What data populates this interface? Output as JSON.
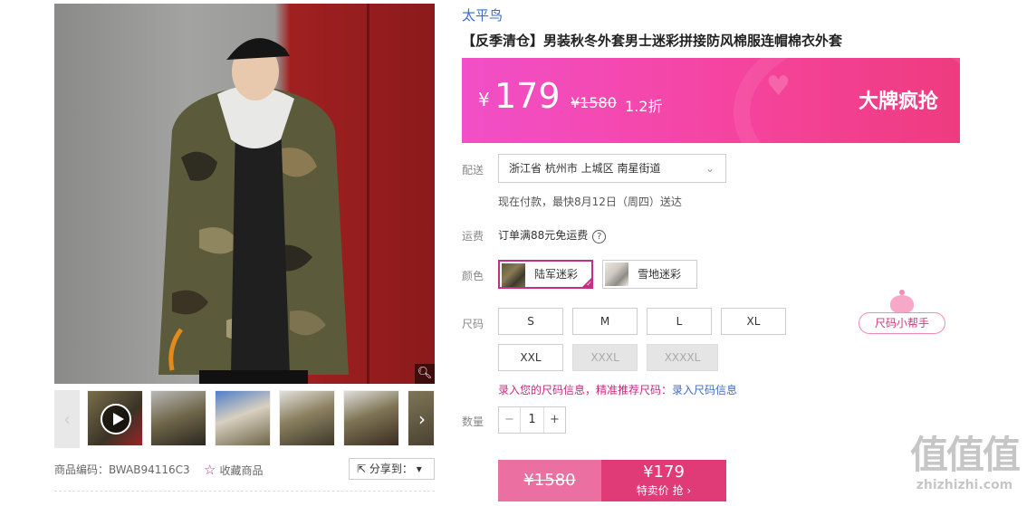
{
  "gallery": {
    "zoom_icon": "magnifier-icon",
    "prev_icon": "chevron-left-icon",
    "next_icon": "chevron-right-icon",
    "play_icon": "play-icon",
    "thumbnail_count": 7
  },
  "meta": {
    "sku": "商品编码：BWAB94116C3",
    "favorite_label": "收藏商品",
    "share_label": "分享到："
  },
  "product": {
    "brand": "太平鸟",
    "title": "【反季清仓】男装秋冬外套男士迷彩拼接防风棉服连帽棉衣外套"
  },
  "price_banner": {
    "currency": "¥",
    "price": "179",
    "original": "¥1580",
    "discount": "1.2折",
    "promo": "大牌疯抢",
    "bg_colors": [
      "#f24fc8",
      "#ee3b7f"
    ]
  },
  "shipping": {
    "label": "配送",
    "address": "浙江省 杭州市 上城区 南星街道",
    "eta": "现在付款，最快8月12日（周四）送达",
    "fee_label": "运费",
    "fee_text": "订单满88元免运费",
    "help_icon": "?"
  },
  "color": {
    "label": "颜色",
    "options": [
      {
        "name": "陆军迷彩",
        "selected": true
      },
      {
        "name": "雪地迷彩",
        "selected": false
      }
    ]
  },
  "size": {
    "label": "尺码",
    "options": [
      {
        "name": "S",
        "available": true
      },
      {
        "name": "M",
        "available": true
      },
      {
        "name": "L",
        "available": true
      },
      {
        "name": "XL",
        "available": true
      },
      {
        "name": "XXL",
        "available": true
      },
      {
        "name": "XXXL",
        "available": false
      },
      {
        "name": "XXXXL",
        "available": false
      }
    ],
    "helper": "尺码小帮手",
    "hint": "录入您的尺码信息，精准推荐尺码：",
    "hint_link": "录入尺码信息"
  },
  "quantity": {
    "label": "数量",
    "value": "1",
    "minus": "−",
    "plus": "+"
  },
  "buy": {
    "original": "¥1580",
    "special_price": "¥179",
    "action": "特卖价 抢 ›"
  },
  "watermark": {
    "big": "值值值",
    "small": "zhizhizhi.com"
  },
  "accent_color": "#c82d84"
}
